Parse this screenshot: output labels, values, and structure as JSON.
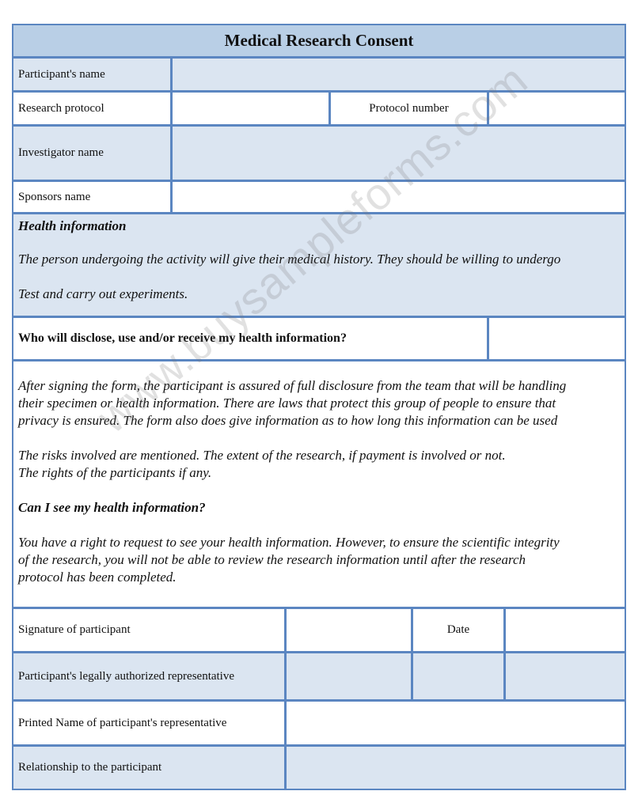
{
  "form": {
    "title": "Medical Research Consent",
    "fields": {
      "participant_name": {
        "label": "Participant's name",
        "value": ""
      },
      "research_protocol": {
        "label": "Research protocol",
        "value": ""
      },
      "protocol_number": {
        "label": "Protocol number",
        "value": ""
      },
      "investigator_name": {
        "label": "Investigator name",
        "value": ""
      },
      "sponsors_name": {
        "label": "Sponsors name",
        "value": ""
      }
    },
    "health_information": {
      "heading": "Health information",
      "line1": "The person undergoing the activity will give their medical history. They should be willing to undergo",
      "line2": "Test and carry out experiments."
    },
    "disclosure_question": {
      "label": "Who will disclose, use and/or receive my health information?",
      "value": ""
    },
    "disclosure_body": {
      "lines": [
        "After signing the form, the participant is assured of full disclosure from the team that will be handling",
        "their specimen or health information. There are laws that protect this group of people to ensure that",
        "privacy is ensured. The form also does give information as to how long this information can be used"
      ],
      "risks_lines": [
        "The risks involved are mentioned. The extent of the research, if payment is involved or not.",
        "The rights of the participants if any."
      ]
    },
    "see_info": {
      "heading": "Can I see my health information?",
      "lines": [
        "You have a right to request to see your health information. However, to ensure the scientific integrity",
        "of the research, you will not be able to review the research information until after the research",
        "protocol has been completed."
      ]
    },
    "signature": {
      "participant_signature_label": "Signature of participant",
      "date_label": "Date",
      "representative_label": "Participant's legally authorized representative",
      "printed_name_label": "Printed Name of participant's representative",
      "relationship_label": "Relationship to the participant"
    }
  },
  "watermark": "www.buysampleforms.com",
  "colors": {
    "border": "#5b86c1",
    "header_fill": "#b9cfe6",
    "light_fill": "#dbe5f1"
  }
}
